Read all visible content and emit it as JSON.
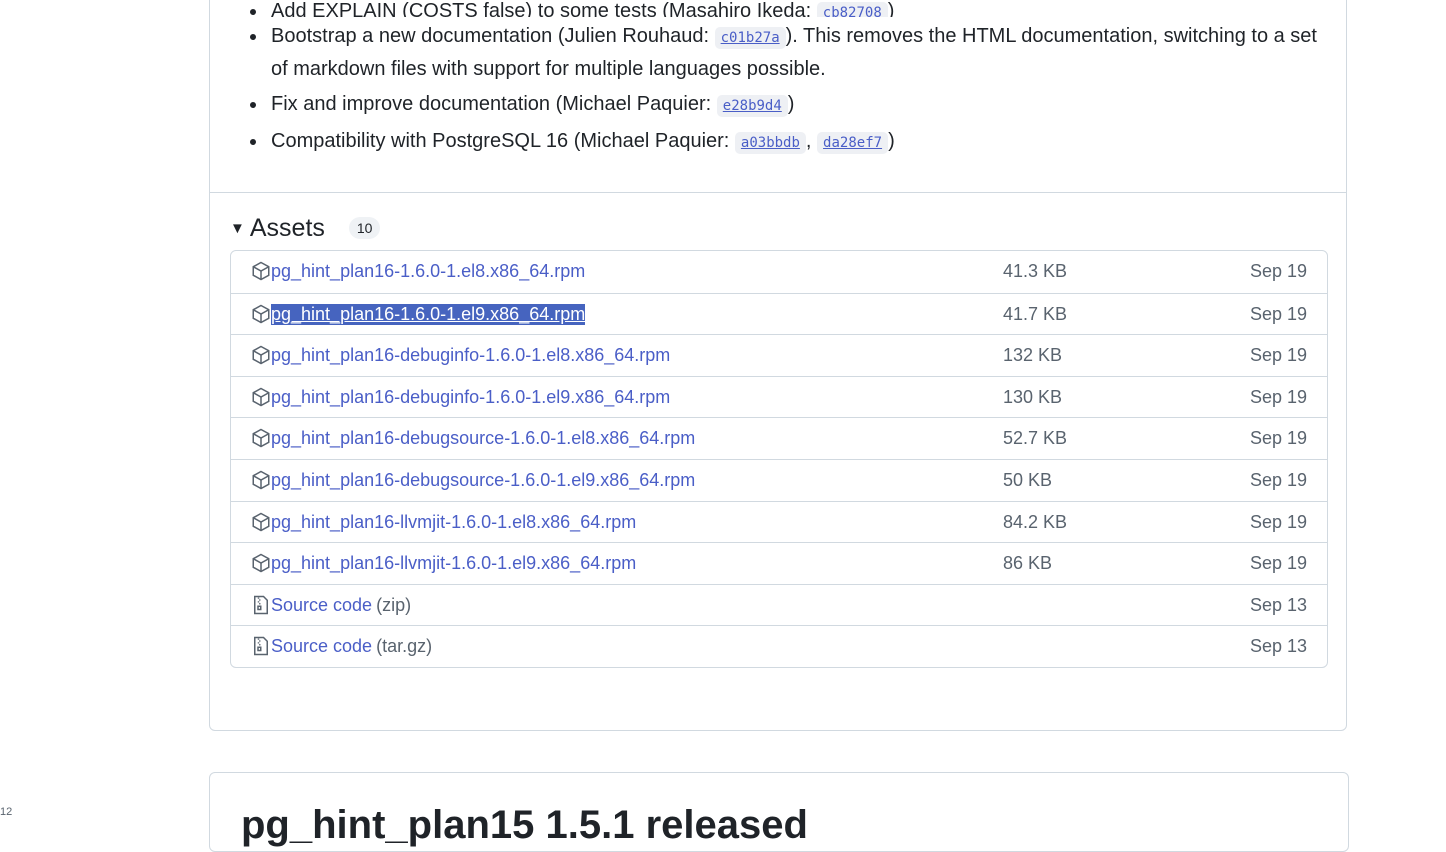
{
  "left_marker": "12",
  "notes": {
    "items": [
      {
        "text_before": "Add EXPLAIN (COSTS false) to some tests (Masahiro Ikeda: ",
        "shas": [
          "cb82708"
        ],
        "text_after": ")"
      },
      {
        "text_before": "Bootstrap a new documentation (Julien Rouhaud: ",
        "shas": [
          "c01b27a"
        ],
        "text_after": "). This removes the HTML documentation, switching to a set of markdown files with support for multiple languages possible."
      },
      {
        "text_before": "Fix and improve documentation (Michael Paquier: ",
        "shas": [
          "e28b9d4"
        ],
        "text_after": ")"
      },
      {
        "text_before": "Compatibility with PostgreSQL 16 (Michael Paquier: ",
        "shas": [
          "a03bbdb",
          "da28ef7"
        ],
        "text_after": ")"
      }
    ]
  },
  "assets": {
    "title": "Assets",
    "count": "10",
    "rows": [
      {
        "name": "pg_hint_plan16-1.6.0-1.el8.x86_64.rpm",
        "suffix": "",
        "size": "41.3 KB",
        "date": "Sep 19",
        "icon": "package-icon",
        "selected": false
      },
      {
        "name": "pg_hint_plan16-1.6.0-1.el9.x86_64.rpm",
        "suffix": "",
        "size": "41.7 KB",
        "date": "Sep 19",
        "icon": "package-icon",
        "selected": true
      },
      {
        "name": "pg_hint_plan16-debuginfo-1.6.0-1.el8.x86_64.rpm",
        "suffix": "",
        "size": "132 KB",
        "date": "Sep 19",
        "icon": "package-icon",
        "selected": false
      },
      {
        "name": "pg_hint_plan16-debuginfo-1.6.0-1.el9.x86_64.rpm",
        "suffix": "",
        "size": "130 KB",
        "date": "Sep 19",
        "icon": "package-icon",
        "selected": false
      },
      {
        "name": "pg_hint_plan16-debugsource-1.6.0-1.el8.x86_64.rpm",
        "suffix": "",
        "size": "52.7 KB",
        "date": "Sep 19",
        "icon": "package-icon",
        "selected": false
      },
      {
        "name": "pg_hint_plan16-debugsource-1.6.0-1.el9.x86_64.rpm",
        "suffix": "",
        "size": "50 KB",
        "date": "Sep 19",
        "icon": "package-icon",
        "selected": false
      },
      {
        "name": "pg_hint_plan16-llvmjit-1.6.0-1.el8.x86_64.rpm",
        "suffix": "",
        "size": "84.2 KB",
        "date": "Sep 19",
        "icon": "package-icon",
        "selected": false
      },
      {
        "name": "pg_hint_plan16-llvmjit-1.6.0-1.el9.x86_64.rpm",
        "suffix": "",
        "size": "86 KB",
        "date": "Sep 19",
        "icon": "package-icon",
        "selected": false
      },
      {
        "name": "Source code",
        "suffix": "(zip)",
        "size": "",
        "date": "Sep 13",
        "icon": "file-zip-icon",
        "selected": false
      },
      {
        "name": "Source code",
        "suffix": "(tar.gz)",
        "size": "",
        "date": "Sep 13",
        "icon": "file-zip-icon",
        "selected": false
      }
    ]
  },
  "next_release": {
    "title": "pg_hint_plan15 1.5.1 released"
  },
  "colors": {
    "link": "#4a5ec7",
    "selection": "#4664bf",
    "border": "#d1d9e0",
    "muted": "#59636e"
  }
}
